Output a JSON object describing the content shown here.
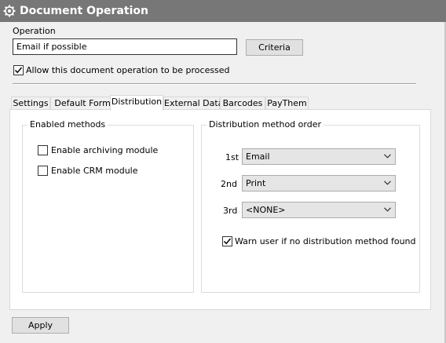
{
  "window": {
    "title": "Document Operation",
    "icon": "gear-icon"
  },
  "operation": {
    "label": "Operation",
    "value": "Email if possible",
    "criteria_button": "Criteria",
    "allow_label": "Allow this document operation to be processed",
    "allow_checked": true
  },
  "tabs": [
    {
      "label": "Settings",
      "active": false
    },
    {
      "label": "Default Forms",
      "active": false
    },
    {
      "label": "Distribution",
      "active": true
    },
    {
      "label": "External Data",
      "active": false
    },
    {
      "label": "Barcodes",
      "active": false
    },
    {
      "label": "PayThem",
      "active": false
    }
  ],
  "enabled_methods": {
    "title": "Enabled methods",
    "archiving_label": "Enable archiving module",
    "archiving_checked": false,
    "crm_label": "Enable CRM module",
    "crm_checked": false
  },
  "distribution_order": {
    "title": "Distribution method order",
    "rows": [
      {
        "ordinal": "1st",
        "value": "Email"
      },
      {
        "ordinal": "2nd",
        "value": "Print"
      },
      {
        "ordinal": "3rd",
        "value": "<NONE>"
      }
    ],
    "warn_label": "Warn user if no distribution method found",
    "warn_checked": true
  },
  "footer": {
    "apply_button": "Apply"
  },
  "colors": {
    "titlebar": "#777777",
    "background": "#f0f0f0",
    "panel": "#ffffff"
  }
}
